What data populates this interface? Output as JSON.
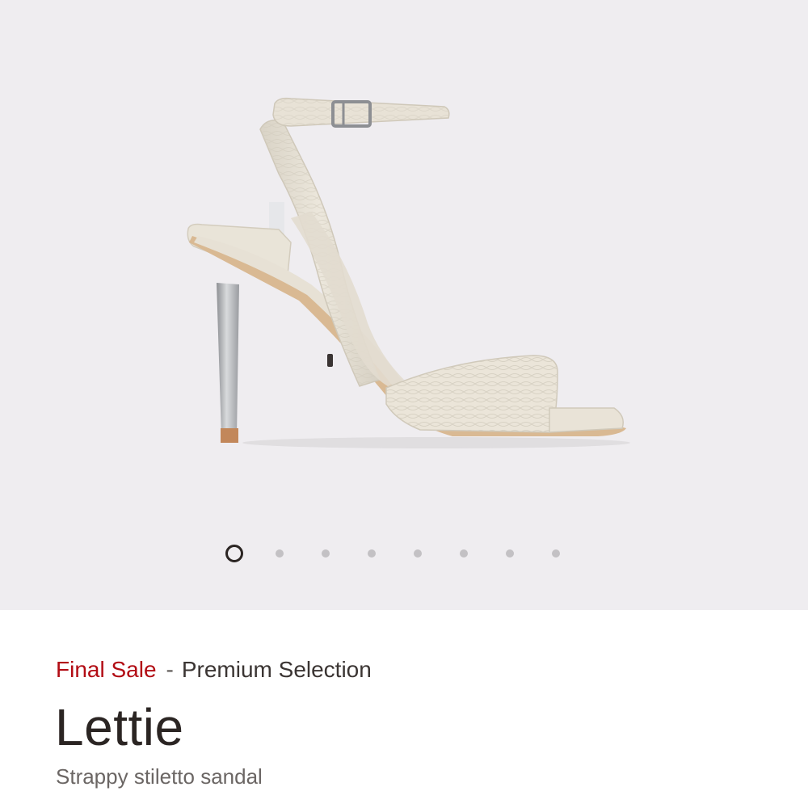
{
  "gallery": {
    "image": "strappy-stiletto-sandal-photo",
    "slide_count": 8,
    "active_slide": 1
  },
  "product": {
    "sale_label": "Final Sale",
    "separator": "-",
    "collection": "Premium Selection",
    "name": "Lettie",
    "description": "Strappy stiletto sandal"
  },
  "colors": {
    "sale": "#b20c14",
    "gallery_bg": "#efedf0",
    "text": "#2b2523"
  }
}
